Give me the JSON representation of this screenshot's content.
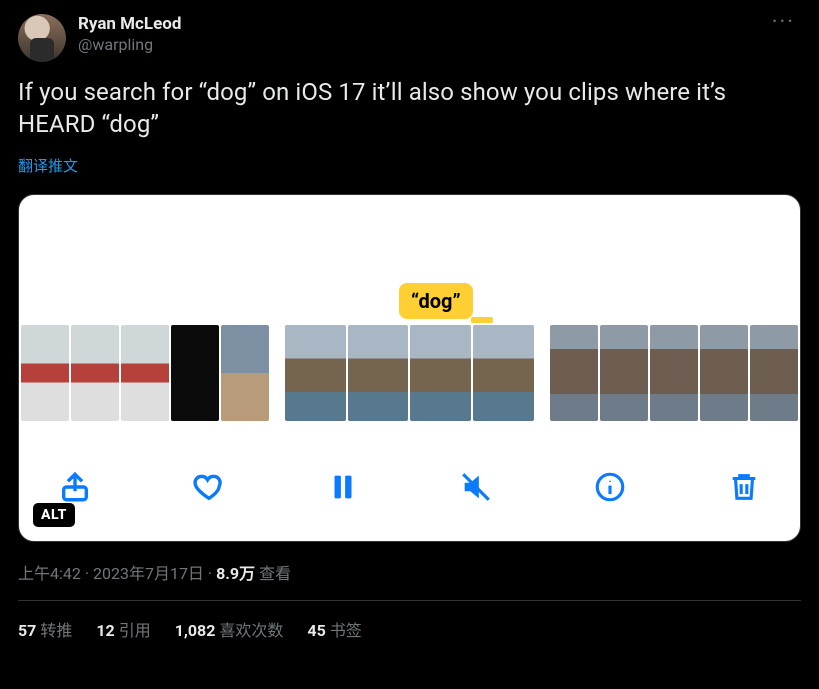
{
  "author": {
    "display_name": "Ryan McLeod",
    "handle": "@warpling"
  },
  "more_label": "···",
  "body_text": "If you search for “dog” on iOS 17 it’ll also show you clips where it’s HEARD “dog”",
  "translate_label": "翻译推文",
  "media": {
    "bubble_label": "“dog”",
    "alt_badge": "ALT",
    "toolbar": {
      "share": "share",
      "like": "like",
      "pause": "pause",
      "mute": "mute",
      "info": "info",
      "trash": "trash"
    }
  },
  "meta": {
    "time": "上午4:42",
    "dot1": " · ",
    "date": "2023年7月17日",
    "dot2": " · ",
    "views_value": "8.9万",
    "views_label": " 查看"
  },
  "stats": {
    "retweets": {
      "value": "57",
      "label": "转推"
    },
    "quotes": {
      "value": "12",
      "label": "引用"
    },
    "likes": {
      "value": "1,082",
      "label": "喜欢次数"
    },
    "bookmarks": {
      "value": "45",
      "label": "书签"
    }
  }
}
